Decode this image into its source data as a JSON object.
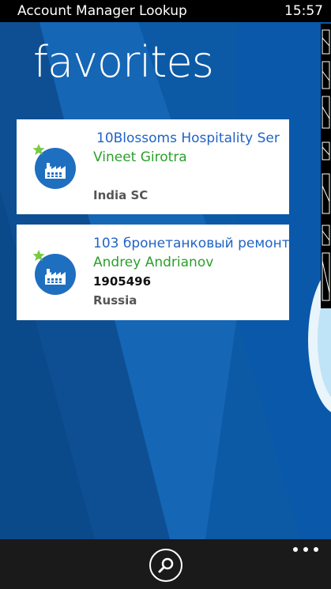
{
  "status_bar": {
    "app_title": "Account Manager Lookup",
    "time": "15:57"
  },
  "page": {
    "title": "favorites"
  },
  "favorites": [
    {
      "name": "10Blossoms Hospitality Ser",
      "manager": "Vineet Girotra",
      "number": "",
      "region": "India SC",
      "icon": "factory-icon",
      "badge_icon": "star-icon"
    },
    {
      "name": "103 бронетанковый ремонт",
      "manager": "Andrey Andrianov",
      "number": "1905496",
      "region": "Russia",
      "icon": "factory-icon",
      "badge_icon": "star-icon"
    }
  ],
  "app_bar": {
    "search_icon": "search-icon",
    "more_icon": "ellipsis-icon"
  },
  "colors": {
    "background": "#0c5aa6",
    "name_text": "#1f63c6",
    "manager_text": "#2ca02c",
    "badge_circle": "#1f6fc0",
    "star": "#7ac943",
    "app_bar": "#1a1a1a"
  }
}
